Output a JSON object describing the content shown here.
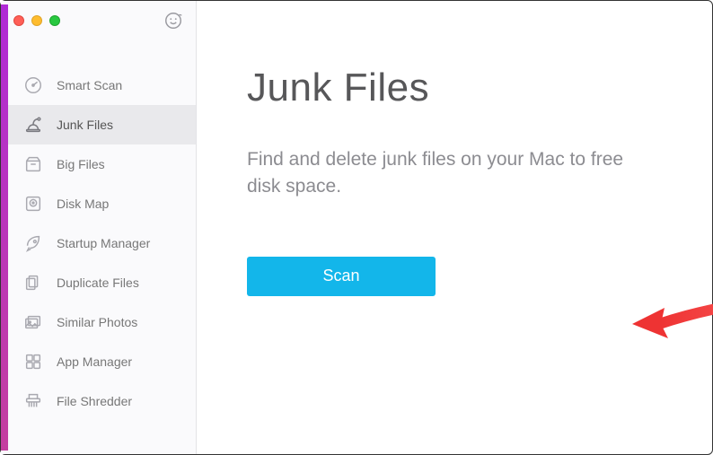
{
  "sidebar": {
    "items": [
      {
        "label": "Smart Scan"
      },
      {
        "label": "Junk Files"
      },
      {
        "label": "Big Files"
      },
      {
        "label": "Disk Map"
      },
      {
        "label": "Startup Manager"
      },
      {
        "label": "Duplicate Files"
      },
      {
        "label": "Similar Photos"
      },
      {
        "label": "App Manager"
      },
      {
        "label": "File Shredder"
      }
    ]
  },
  "main": {
    "heading": "Junk Files",
    "subtitle": "Find and delete junk files on your Mac to free disk space.",
    "scan_button": "Scan"
  },
  "colors": {
    "accent": "#13b6ea"
  }
}
